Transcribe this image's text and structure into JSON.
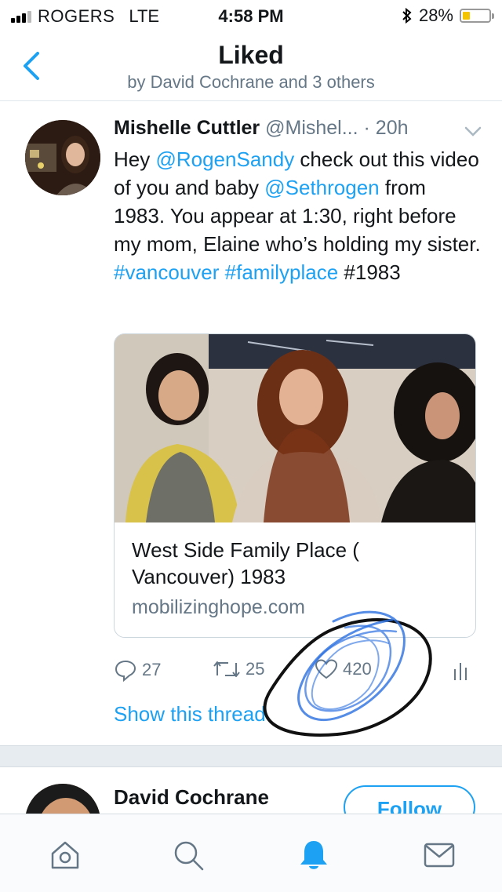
{
  "status_bar": {
    "carrier": "ROGERS",
    "network": "LTE",
    "time": "4:58 PM",
    "battery": "28%",
    "battery_level": 0.28,
    "icons": [
      "signal-icon",
      "bluetooth-icon",
      "battery-icon"
    ]
  },
  "header": {
    "title": "Liked",
    "subtitle": "by David Cochrane and 3 others",
    "back_icon": "chevron-left-icon"
  },
  "tweet": {
    "author_name": "Mishelle Cuttler",
    "handle": "@Mishel...",
    "time": "· 20h",
    "text": {
      "t1": "Hey ",
      "mention1": "@RogenSandy",
      "t2": " check out this video of you and baby ",
      "mention2": "@Sethrogen",
      "t3": " from 1983. You appear at 1:30, right before my mom, Elaine who’s holding my sister. ",
      "hashtag1": "#vancouver",
      "hashtag2": "#familyplace",
      "t4": " #1983"
    },
    "card": {
      "title": "West Side Family Place ( Vancouver) 1983",
      "domain": "mobilizinghope.com"
    },
    "actions": {
      "replies": "27",
      "retweets": "25",
      "likes": "420"
    },
    "show_thread": "Show this thread"
  },
  "next_tweet": {
    "author_name": "David Cochrane",
    "follow_label": "Follow"
  },
  "tab_bar": {
    "tabs": [
      "home-icon",
      "search-icon",
      "notifications-icon",
      "messages-icon"
    ],
    "active": "notifications-icon"
  },
  "colors": {
    "accent": "#1da1f2",
    "muted": "#657786",
    "text": "#14171a",
    "annotation_blue": "#2b6fe0",
    "annotation_black": "#111111"
  }
}
